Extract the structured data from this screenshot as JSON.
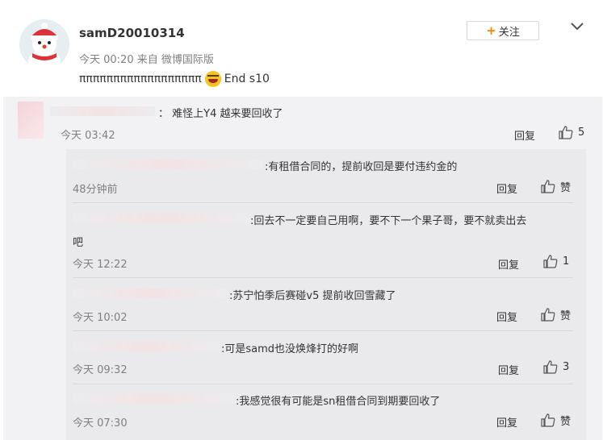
{
  "post": {
    "username": "samD20010314",
    "meta": "今天 00:20 来自 微博国际版",
    "text": "ππππππππππππππππππ",
    "text_end": "End s10",
    "follow_label": "关注",
    "follow_plus": "+"
  },
  "comment": {
    "text": "： 难怪上Y4  越来要回收了",
    "time": "今天 03:42",
    "reply": "回复",
    "likes": "5"
  },
  "replies": [
    {
      "text": ":有租借合同的，提前收回是要付违约金的",
      "time": "48分钟前",
      "reply": "回复",
      "likes": "赞"
    },
    {
      "text": ":回去不一定要自己用啊，要不下一个果子哥，要不就卖出去",
      "text2": "吧",
      "time": "今天 12:22",
      "reply": "回复",
      "likes": "1"
    },
    {
      "text": ":苏宁怕季后赛碰v5 提前收回雪藏了",
      "time": "今天 10:02",
      "reply": "回复",
      "likes": "赞"
    },
    {
      "text": ":可是samd也没焕烽打的好啊",
      "time": "今天 09:32",
      "reply": "回复",
      "likes": "3"
    },
    {
      "text": ":我感觉很有可能是sn租借合同到期要回收了",
      "time": "今天 07:30",
      "reply": "回复",
      "likes": "赞"
    }
  ],
  "icons": {
    "avatar": "snowman-avatar",
    "chevron": "chevron-down-icon",
    "thumb": "thumbs-up-icon",
    "emoji": "laughing-tears-emoji"
  },
  "colors": {
    "accent": "#ff8200",
    "meta_text": "#808080",
    "panel_bg": "#f2f2f5",
    "subpanel_bg": "#eaeaec"
  }
}
